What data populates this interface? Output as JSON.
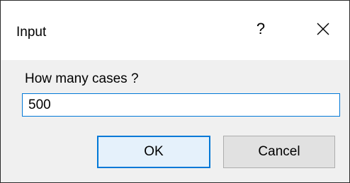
{
  "dialog": {
    "title": "Input",
    "help_glyph": "?",
    "prompt": "How many cases ?",
    "input_value": "500",
    "ok_label": "OK",
    "cancel_label": "Cancel"
  },
  "colors": {
    "focus_accent": "#0078d7",
    "dialog_background": "#f0f0f0",
    "titlebar_background": "#ffffff",
    "button_background": "#e1e1e1"
  },
  "icons": {
    "help": "help-icon",
    "close": "close-icon"
  }
}
